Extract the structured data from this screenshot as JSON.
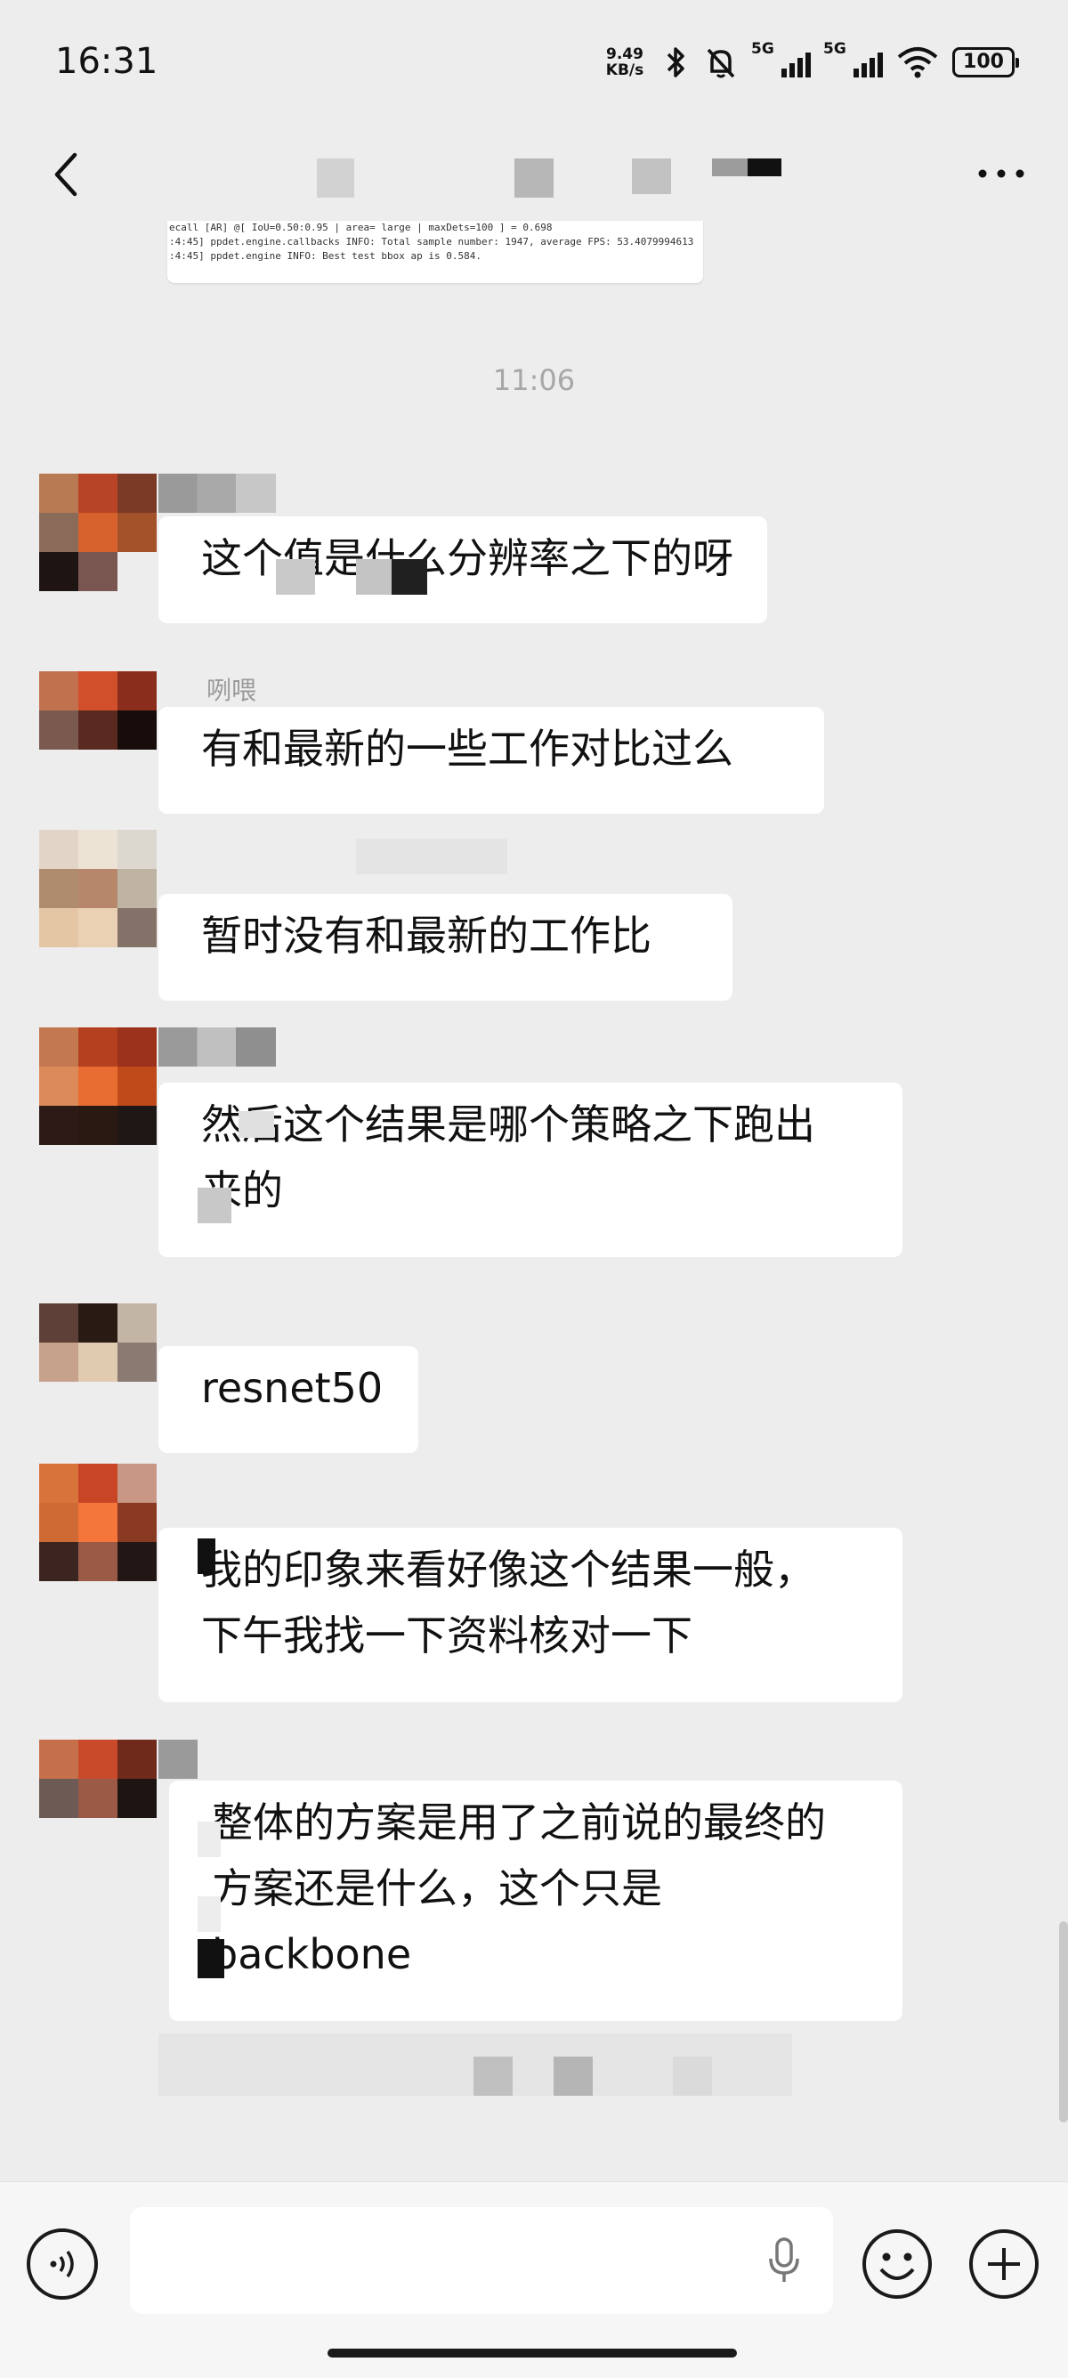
{
  "status_bar": {
    "time": "16:31",
    "net_speed_value": "9.49",
    "net_speed_unit": "KB/s",
    "sim1_label": "5G",
    "sim2_label": "5G",
    "battery": "100"
  },
  "divider_time": "11:06",
  "log_image": {
    "lines": [
      "ecall    [AR] @[ IoU=0.50:0.95 | area= large | maxDets=100 ] = 0.698",
      ":4:45] ppdet.engine.callbacks INFO: Total sample number: 1947, average FPS: 53.4079994613",
      ":4:45] ppdet.engine INFO: Best test bbox ap is 0.584."
    ]
  },
  "messages": [
    {
      "sender": "",
      "text": "这个值是什么分辨率之下的呀"
    },
    {
      "sender": "咧喂",
      "text": "有和最新的一些工作对比过么"
    },
    {
      "sender": "",
      "text": "暂时没有和最新的工作比"
    },
    {
      "sender": "",
      "text": "然后这个结果是哪个策略之下跑出\n来的"
    },
    {
      "sender": "",
      "text": "resnet50"
    },
    {
      "sender": "",
      "text": "我的印象来看好像这个结果一般，\n下午我找一下资料核对一下"
    },
    {
      "sender": "",
      "text": "整体的方案是用了之前说的最终的\n方案还是什么，这个只是\nbackbone"
    }
  ],
  "input": {
    "placeholder": "",
    "value": ""
  },
  "icons": {
    "back": "back-arrow-icon",
    "more": "more-dots-icon",
    "voice": "voice-icon",
    "mic": "mic-icon",
    "emoji": "emoji-icon",
    "add": "add-icon"
  },
  "colors": {
    "background": "#ededed",
    "bubble": "#ffffff",
    "text": "#111111",
    "time_text": "#a7a7a7"
  }
}
